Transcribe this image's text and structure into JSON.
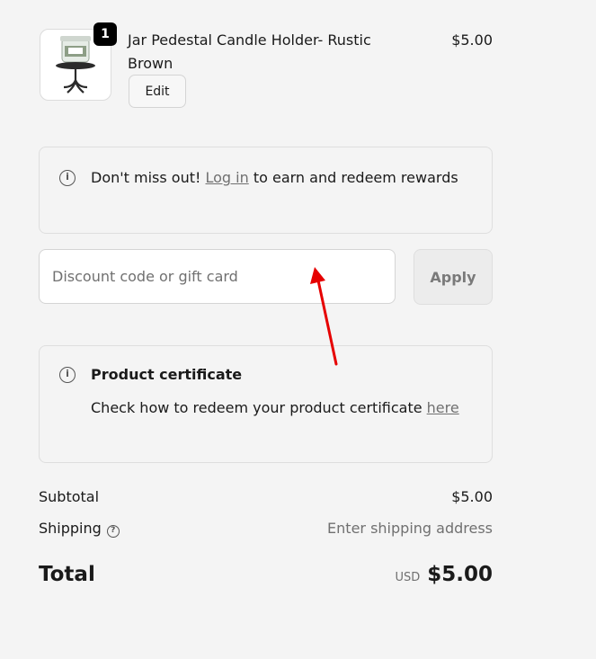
{
  "item": {
    "quantity": "1",
    "name": "Jar Pedestal Candle Holder- Rustic Brown",
    "price": "$5.00",
    "edit_label": "Edit",
    "image_alt_icon": "candle-holder-image"
  },
  "rewards": {
    "icon": "info-icon",
    "text_before": "Don't miss out! ",
    "login_link": "Log in",
    "text_after": " to earn and redeem rewards"
  },
  "discount": {
    "placeholder": "Discount code or gift card",
    "value": "",
    "apply_label": "Apply"
  },
  "certificate": {
    "icon": "info-icon",
    "title": "Product certificate",
    "body": "Check how to redeem your product certificate ",
    "link": "here"
  },
  "summary": {
    "subtotal_label": "Subtotal",
    "subtotal_value": "$5.00",
    "shipping_label": "Shipping",
    "shipping_value": "Enter shipping address",
    "total_label": "Total",
    "currency": "USD",
    "total_value": "$5.00"
  },
  "colors": {
    "annotation_arrow": "#e60000",
    "background": "#f4f4f4"
  }
}
